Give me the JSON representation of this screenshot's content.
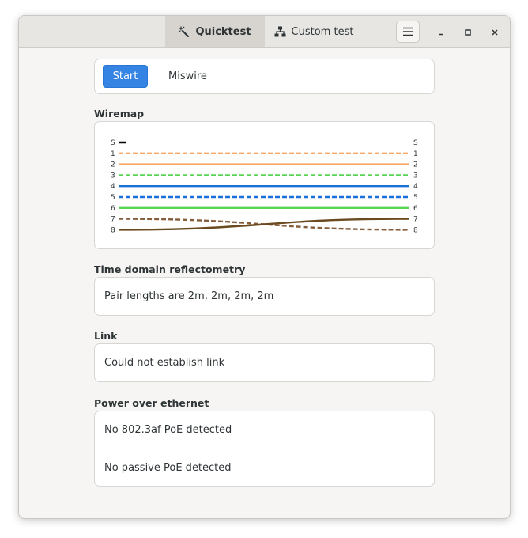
{
  "tabs": [
    {
      "label": "Quicktest",
      "icon": "magic-wand-icon",
      "active": true
    },
    {
      "label": "Custom test",
      "icon": "network-icon",
      "active": false
    }
  ],
  "test": {
    "start_label": "Start",
    "status": "Miswire"
  },
  "wiremap": {
    "heading": "Wiremap",
    "left_labels": [
      "S",
      "1",
      "2",
      "3",
      "4",
      "5",
      "6",
      "7",
      "8"
    ],
    "right_labels": [
      "S",
      "1",
      "2",
      "3",
      "4",
      "5",
      "6",
      "7",
      "8"
    ],
    "wires": [
      {
        "pin": "1",
        "color": "#f6a768",
        "dashed": true,
        "to": "1"
      },
      {
        "pin": "2",
        "color": "#f6a768",
        "dashed": false,
        "to": "2"
      },
      {
        "pin": "3",
        "color": "#57d653",
        "dashed": true,
        "to": "3"
      },
      {
        "pin": "4",
        "color": "#1c71d8",
        "dashed": false,
        "to": "4"
      },
      {
        "pin": "5",
        "color": "#1c71d8",
        "dashed": true,
        "to": "5"
      },
      {
        "pin": "6",
        "color": "#57d653",
        "dashed": false,
        "to": "6"
      },
      {
        "pin": "7",
        "color": "#865e3c",
        "dashed": true,
        "to": "8"
      },
      {
        "pin": "8",
        "color": "#6a4a1e",
        "dashed": false,
        "to": "7"
      }
    ]
  },
  "tdr": {
    "heading": "Time domain reflectometry",
    "text": "Pair lengths are 2m, 2m, 2m, 2m"
  },
  "link": {
    "heading": "Link",
    "text": "Could not establish link"
  },
  "poe": {
    "heading": "Power over ethernet",
    "rows": [
      "No 802.3af PoE detected",
      "No passive PoE detected"
    ]
  }
}
